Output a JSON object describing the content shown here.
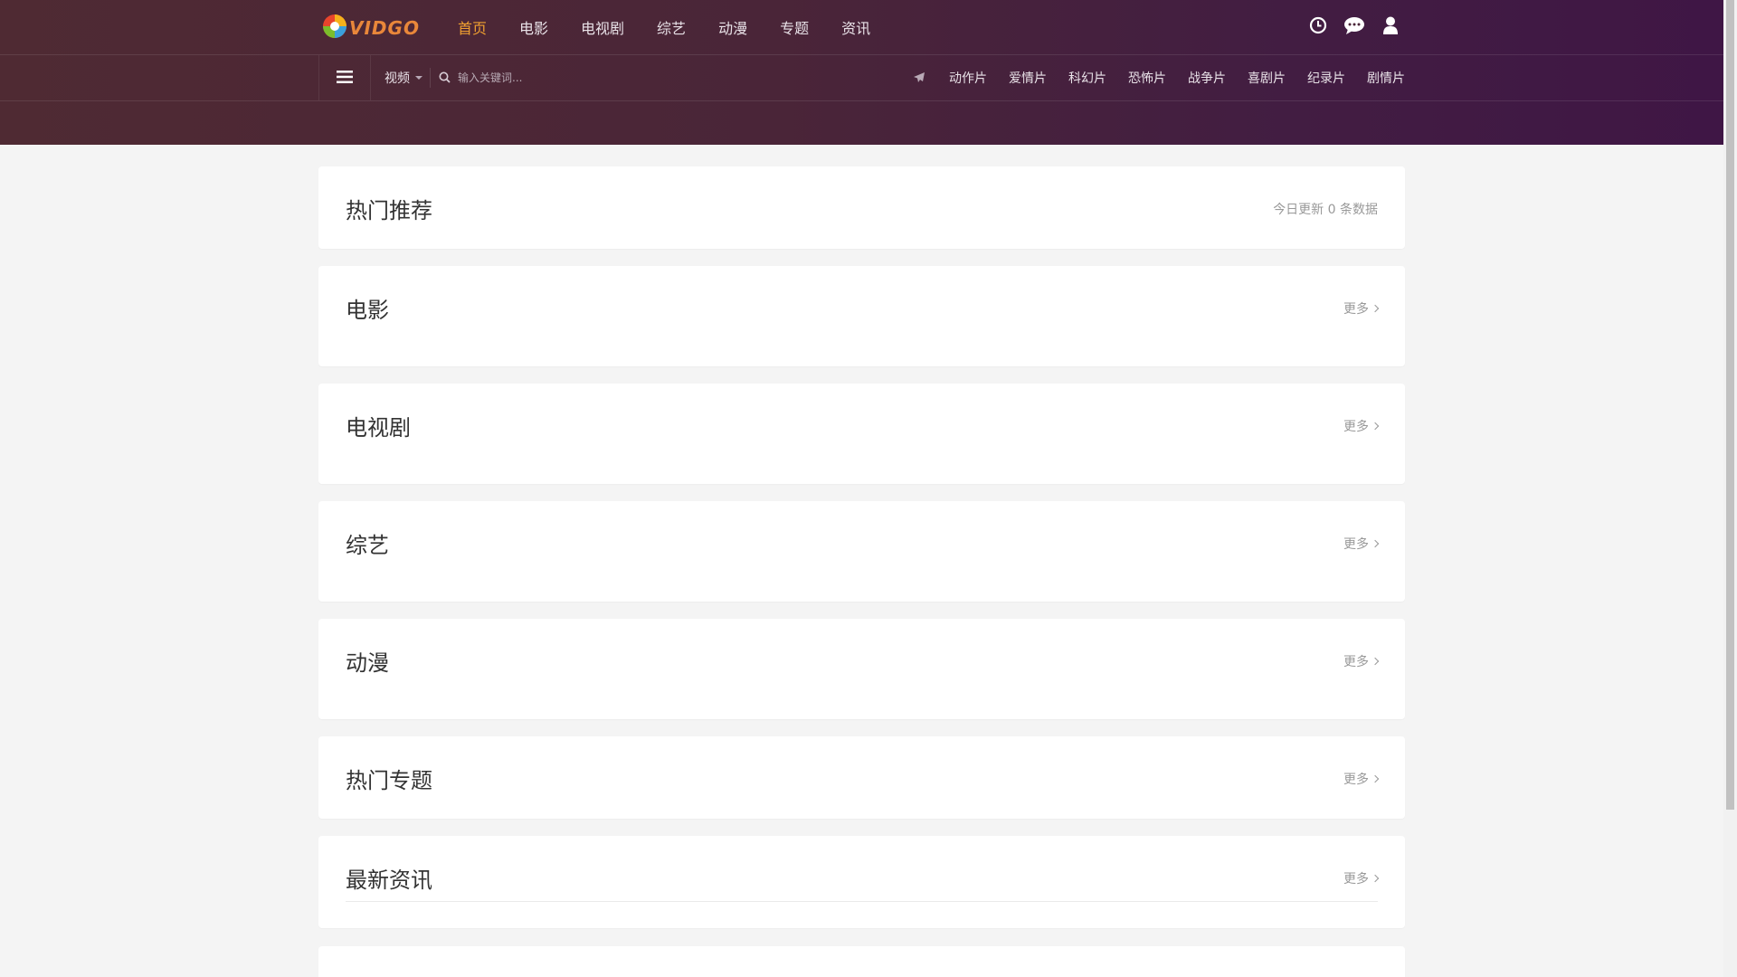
{
  "brand": {
    "logo_text": "VIDGO"
  },
  "nav": {
    "items": [
      {
        "label": "首页",
        "active": true
      },
      {
        "label": "电影"
      },
      {
        "label": "电视剧"
      },
      {
        "label": "综艺"
      },
      {
        "label": "动漫"
      },
      {
        "label": "专题"
      },
      {
        "label": "资讯"
      }
    ]
  },
  "top_icons": [
    "clock-icon",
    "chat-icon",
    "user-icon"
  ],
  "subbar": {
    "type_select": "视频",
    "search_placeholder": "输入关键词...",
    "categories": [
      "动作片",
      "爱情片",
      "科幻片",
      "恐怖片",
      "战争片",
      "喜剧片",
      "纪录片",
      "剧情片"
    ]
  },
  "sections": {
    "hot": {
      "title": "热门推荐",
      "info": "今日更新 0 条数据"
    },
    "movie": {
      "title": "电影",
      "more": "更多"
    },
    "tv": {
      "title": "电视剧",
      "more": "更多"
    },
    "variety": {
      "title": "综艺",
      "more": "更多"
    },
    "anime": {
      "title": "动漫",
      "more": "更多"
    },
    "topics": {
      "title": "热门专题",
      "more": "更多"
    },
    "news": {
      "title": "最新资讯",
      "more": "更多"
    }
  },
  "colors": {
    "accent": "#f0a030",
    "header_start": "#4f2a33",
    "header_end": "#3f1645"
  }
}
